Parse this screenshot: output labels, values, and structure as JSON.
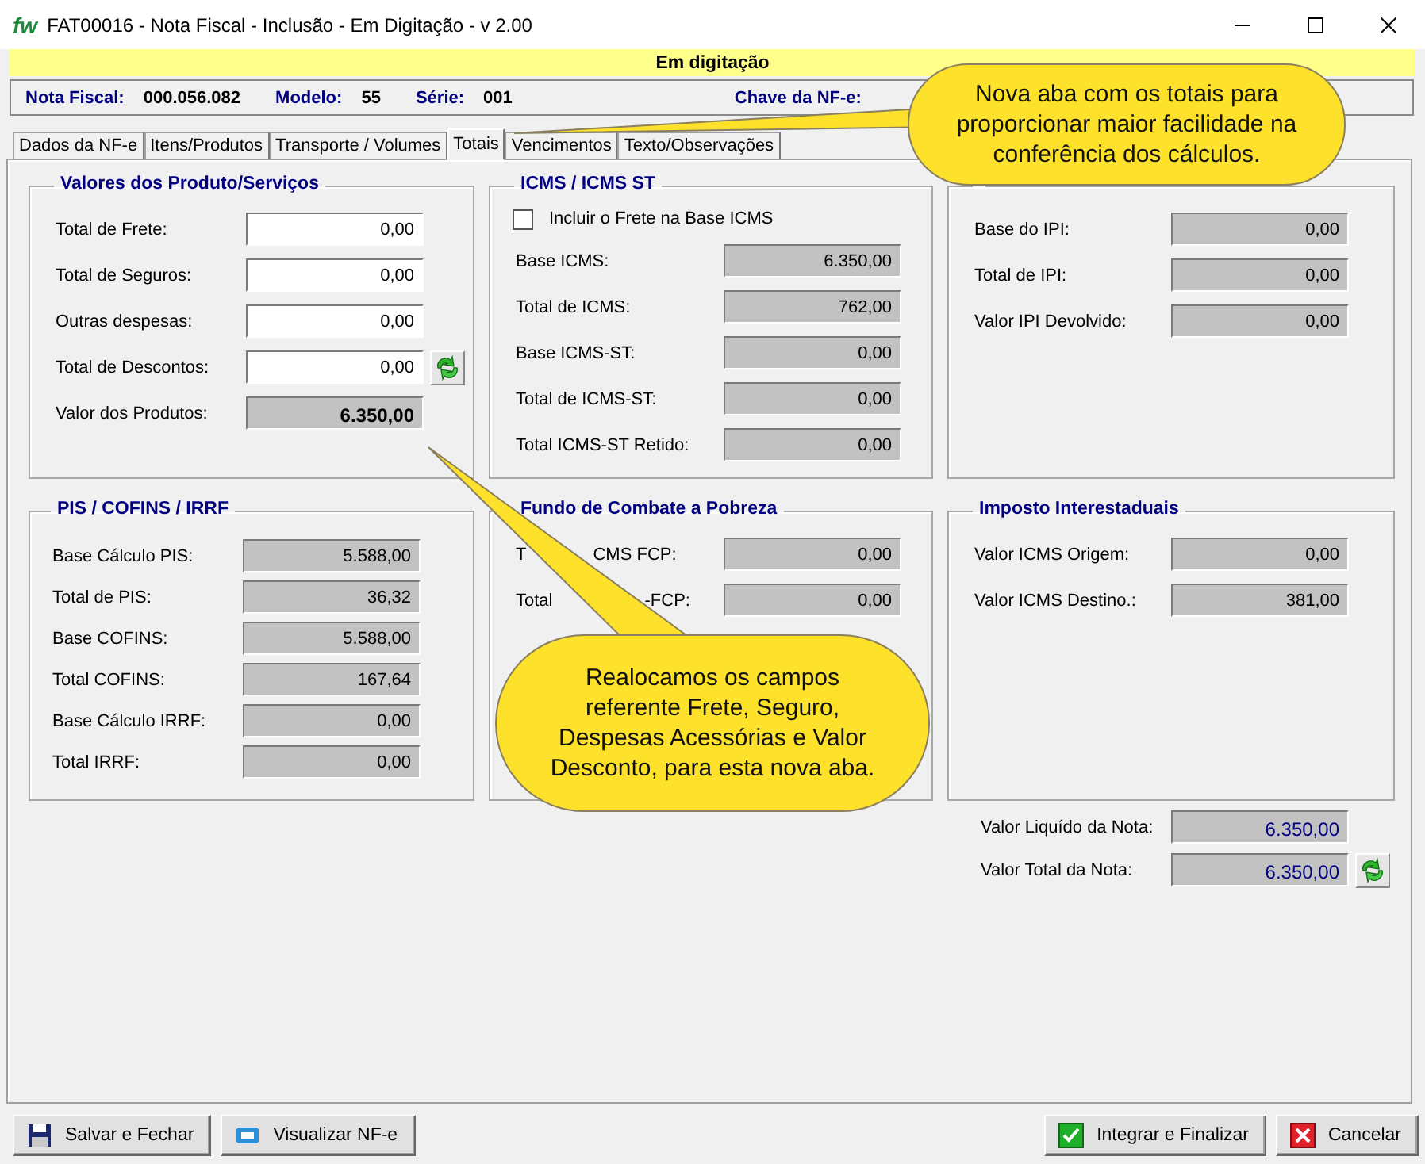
{
  "window": {
    "logo": "fw",
    "title": "FAT00016 - Nota Fiscal - Inclusão - Em Digitação - v 2.00"
  },
  "status_banner": {
    "text": "Em digitação"
  },
  "header": [
    {
      "label": "Nota Fiscal:",
      "value": "000.056.082"
    },
    {
      "label": "Modelo:",
      "value": "55"
    },
    {
      "label": "Série:",
      "value": "001"
    },
    {
      "label": "Chave da NF-e:"
    }
  ],
  "tabs": [
    {
      "label": "Dados da NF-e",
      "selected": false
    },
    {
      "label": "Itens/Produtos",
      "selected": false
    },
    {
      "label": "Transporte / Volumes",
      "selected": false
    },
    {
      "label": "Totais",
      "selected": true
    },
    {
      "label": "Vencimentos",
      "selected": false
    },
    {
      "label": "Texto/Observações",
      "selected": false
    }
  ],
  "groups": [
    {
      "title": "Valores dos Produto/Serviços",
      "rows": [
        {
          "kind": "input",
          "label": "Total de Frete:",
          "value": "0,00"
        },
        {
          "kind": "input",
          "label": "Total de Seguros:",
          "value": "0,00"
        },
        {
          "kind": "input",
          "label": "Outras despesas:",
          "value": "0,00"
        },
        {
          "kind": "input",
          "label": "Total de Descontos:",
          "value": "0,00",
          "has_button": true
        },
        {
          "kind": "total",
          "label": "Valor dos Produtos:",
          "value": "6.350,00"
        }
      ]
    },
    {
      "title": "ICMS / ICMS ST",
      "rows": [
        {
          "kind": "checkbox",
          "label": "Incluir o Frete na Base ICMS",
          "checked": false
        },
        {
          "kind": "readonly",
          "label": "Base ICMS:",
          "value": "6.350,00"
        },
        {
          "kind": "readonly",
          "label": "Total de ICMS:",
          "value": "762,00"
        },
        {
          "kind": "readonly",
          "label": "Base ICMS-ST:",
          "value": "0,00"
        },
        {
          "kind": "readonly",
          "label": "Total de ICMS-ST:",
          "value": "0,00"
        },
        {
          "kind": "readonly",
          "label": "Total ICMS-ST Retido:",
          "value": "0,00"
        }
      ]
    },
    {
      "rows": [
        {
          "kind": "readonly",
          "label": "Base do IPI:",
          "value": "0,00"
        },
        {
          "kind": "readonly",
          "label": "Total de IPI:",
          "value": "0,00"
        },
        {
          "kind": "readonly",
          "label": "Valor IPI Devolvido:",
          "value": "0,00"
        }
      ]
    },
    {
      "title": "PIS / COFINS / IRRF",
      "rows": [
        {
          "kind": "readonly",
          "label": "Base Cálculo PIS:",
          "value": "5.588,00"
        },
        {
          "kind": "readonly",
          "label": "Total de PIS:",
          "value": "36,32"
        },
        {
          "kind": "readonly",
          "label": "Base COFINS:",
          "value": "5.588,00"
        },
        {
          "kind": "readonly",
          "label": "Total COFINS:",
          "value": "167,64"
        },
        {
          "kind": "readonly",
          "label": "Base Cálculo IRRF:",
          "value": "0,00"
        },
        {
          "kind": "readonly",
          "label": "Total IRRF:",
          "value": "0,00"
        }
      ]
    },
    {
      "title": "Fundo de Combate a Pobreza",
      "rows": [
        {
          "kind": "readonly",
          "label_parts": [
            "T",
            "CMS FCP:"
          ],
          "value": "0,00"
        },
        {
          "kind": "readonly",
          "label_parts": [
            "Total",
            "-FCP:"
          ],
          "value": "0,00"
        }
      ]
    },
    {
      "title": "Imposto Interestaduais",
      "rows": [
        {
          "kind": "readonly",
          "label": "Valor ICMS Origem:",
          "value": "0,00"
        },
        {
          "kind": "readonly",
          "label": "Valor ICMS Destino.:",
          "value": "381,00"
        }
      ]
    }
  ],
  "totals": [
    {
      "label": "Valor Liquído da Nota:",
      "value": "6.350,00"
    },
    {
      "label": "Valor Total da Nota:",
      "value": "6.350,00",
      "has_button": true
    }
  ],
  "callouts": [
    {
      "text": "Nova aba com os totais para proporcionar maior facilidade na conferência dos cálculos."
    },
    {
      "text": "Realocamos os campos referente Frete, Seguro, Despesas Acessórias e Valor Desconto, para esta nova aba."
    }
  ],
  "buttons_left": [
    {
      "label": "Salvar e Fechar",
      "kind": "save"
    },
    {
      "label": "Visualizar NF-e",
      "kind": "document"
    }
  ],
  "buttons_right": [
    {
      "label": "Integrar e Finalizar",
      "kind": "confirm"
    },
    {
      "label": "Cancelar",
      "kind": "cancel"
    }
  ]
}
